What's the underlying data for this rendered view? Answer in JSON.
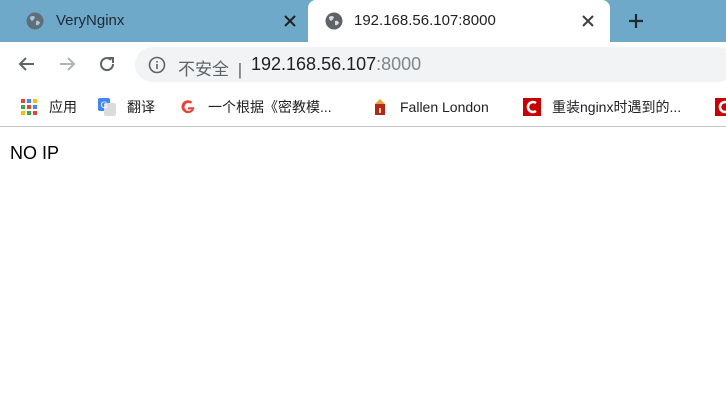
{
  "tabs": [
    {
      "title": "VeryNginx",
      "active": false
    },
    {
      "title": "192.168.56.107:8000",
      "active": true
    }
  ],
  "address_bar": {
    "security_label": "不安全",
    "separator": "|",
    "url_host": "192.168.56.107",
    "url_port": ":8000"
  },
  "bookmarks": [
    {
      "label": "应用",
      "icon": "apps-grid-icon"
    },
    {
      "label": "翻译",
      "icon": "translate-icon"
    },
    {
      "label": "一个根据《密教模...",
      "icon": "google-icon"
    },
    {
      "label": "Fallen London",
      "icon": "fallen-london-icon"
    },
    {
      "label": "重装nginx时遇到的...",
      "icon": "csdn-icon"
    }
  ],
  "page": {
    "text": "NO IP"
  },
  "colors": {
    "tab_strip": "#6fa9c9",
    "omnibox": "#f1f3f4",
    "csdn_red": "#c90000"
  }
}
